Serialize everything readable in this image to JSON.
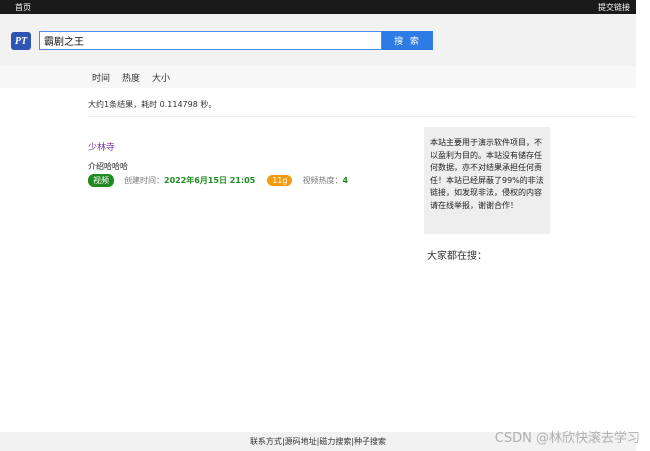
{
  "topbar": {
    "home": "首页",
    "submit_link": "提交链接"
  },
  "header": {
    "logo_text": "PT",
    "search_value": "霸剧之王",
    "search_button": "搜 索"
  },
  "sort": {
    "time": "时间",
    "popularity": "热度",
    "size": "大小"
  },
  "results_summary": "大约1条结果，耗时 0.114798 秒。",
  "results": [
    {
      "title": "少林寺",
      "description": "介绍哈哈哈",
      "type_badge": "视频",
      "created_label": "创建时间：",
      "created_value": "2022年6月15日 21:05",
      "size_badge": "11g",
      "heat_label": "视频热度：",
      "heat_value": "4"
    }
  ],
  "notice_text": "本站主要用于演示软件项目，不以盈利为目的。本站没有储存任何数据，亦不对结果承担任何责任！本站已经屏蔽了99%的非法链接，如发现非法，侵权的内容请在线举报，谢谢合作！",
  "everyone_searching": "大家都在搜：",
  "footer": {
    "contact": "联系方式",
    "source": "源码地址",
    "magnet": "磁力搜索",
    "seed": "种子搜索"
  },
  "watermark": "CSDN @林欣快滚去学习",
  "colors": {
    "accent": "#2f7be6",
    "video_badge": "#1f8a1f",
    "size_badge": "#f39c12",
    "title_link": "#7b2fa0"
  }
}
